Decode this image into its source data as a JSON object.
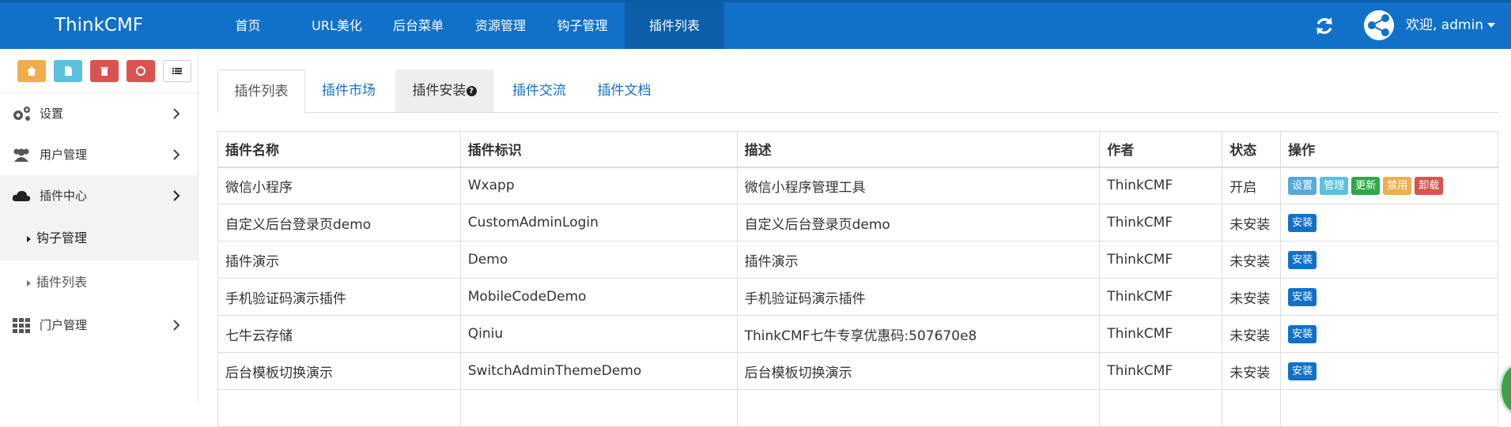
{
  "brand": "ThinkCMF",
  "nav": [
    {
      "label": "首页",
      "active": false
    },
    {
      "label": "URL美化",
      "active": false
    },
    {
      "label": "后台菜单",
      "active": false
    },
    {
      "label": "资源管理",
      "active": false
    },
    {
      "label": "钩子管理",
      "active": false
    },
    {
      "label": "插件列表",
      "active": true
    }
  ],
  "user": {
    "greeting": "欢迎, admin"
  },
  "shortcuts": [
    {
      "icon": "home-icon",
      "color": "#f0ad4e"
    },
    {
      "icon": "file-icon",
      "color": "#5bc0de"
    },
    {
      "icon": "trash-icon",
      "color": "#d9534f"
    },
    {
      "icon": "recycle-icon",
      "color": "#d9534f"
    },
    {
      "icon": "list-icon",
      "color": "#ffffff"
    }
  ],
  "sidebar": {
    "items": [
      {
        "label": "设置",
        "icon": "gears-icon"
      },
      {
        "label": "用户管理",
        "icon": "users-icon"
      },
      {
        "label": "插件中心",
        "icon": "cloud-icon"
      },
      {
        "label": "门户管理",
        "icon": "grid-icon"
      }
    ],
    "sub": [
      {
        "label": "钩子管理"
      },
      {
        "label": "插件列表"
      }
    ]
  },
  "tabs": [
    {
      "label": "插件列表"
    },
    {
      "label": "插件市场"
    },
    {
      "label": "插件安装"
    },
    {
      "label": "插件交流"
    },
    {
      "label": "插件文档"
    }
  ],
  "table": {
    "headers": [
      "插件名称",
      "插件标识",
      "描述",
      "作者",
      "状态",
      "操作"
    ],
    "rows": [
      {
        "name": "微信小程序",
        "id": "Wxapp",
        "desc": "微信小程序管理工具",
        "author": "ThinkCMF",
        "status": "开启"
      },
      {
        "name": "自定义后台登录页demo",
        "id": "CustomAdminLogin",
        "desc": "自定义后台登录页demo",
        "author": "ThinkCMF",
        "status": "未安装"
      },
      {
        "name": "插件演示",
        "id": "Demo",
        "desc": "插件演示",
        "author": "ThinkCMF",
        "status": "未安装"
      },
      {
        "name": "手机验证码演示插件",
        "id": "MobileCodeDemo",
        "desc": "手机验证码演示插件",
        "author": "ThinkCMF",
        "status": "未安装"
      },
      {
        "name": "七牛云存储",
        "id": "Qiniu",
        "desc": "ThinkCMF七牛专享优惠码:507670e8",
        "author": "ThinkCMF",
        "status": "未安装"
      },
      {
        "name": "后台模板切换演示",
        "id": "SwitchAdminThemeDemo",
        "desc": "后台模板切换演示",
        "author": "ThinkCMF",
        "status": "未安装"
      }
    ],
    "actions_enabled": [
      "设置",
      "管理",
      "更新",
      "禁用",
      "卸载"
    ],
    "action_install": "安装"
  },
  "colors": {
    "primary": "#1171c9",
    "nav_active": "#0d5ea9"
  }
}
